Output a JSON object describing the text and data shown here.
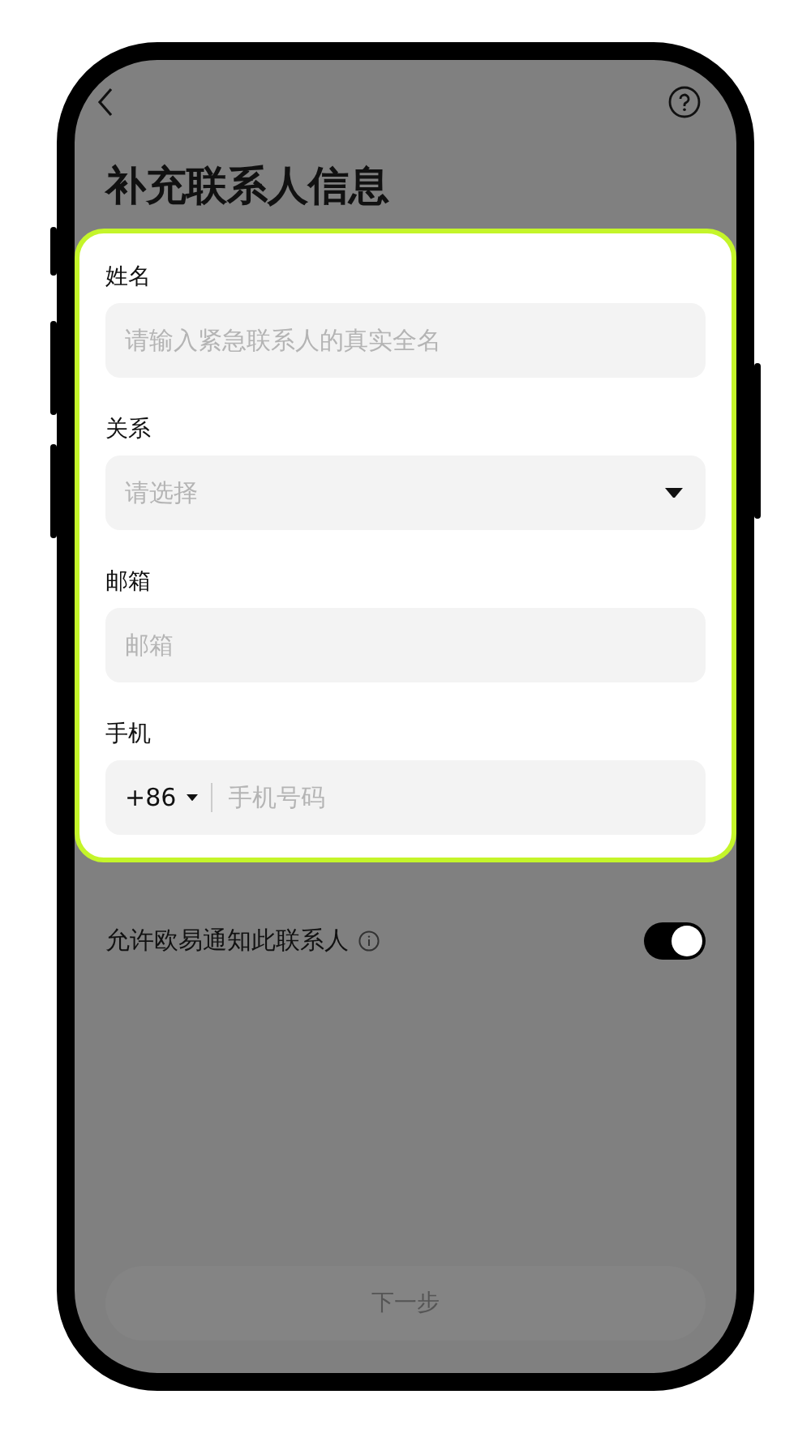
{
  "title": "补充联系人信息",
  "fields": [
    {
      "kind": "text",
      "label": "姓名",
      "placeholder": "请输入紧急联系人的真实全名"
    },
    {
      "kind": "select",
      "label": "关系",
      "placeholder": "请选择"
    },
    {
      "kind": "text",
      "label": "邮箱",
      "placeholder": "邮箱"
    },
    {
      "kind": "phone",
      "label": "手机",
      "code": "+86",
      "placeholder": "手机号码"
    }
  ],
  "notify": {
    "label": "允许欧易通知此联系人",
    "on": true
  },
  "next_button": {
    "label": "下一步",
    "disabled": true
  }
}
